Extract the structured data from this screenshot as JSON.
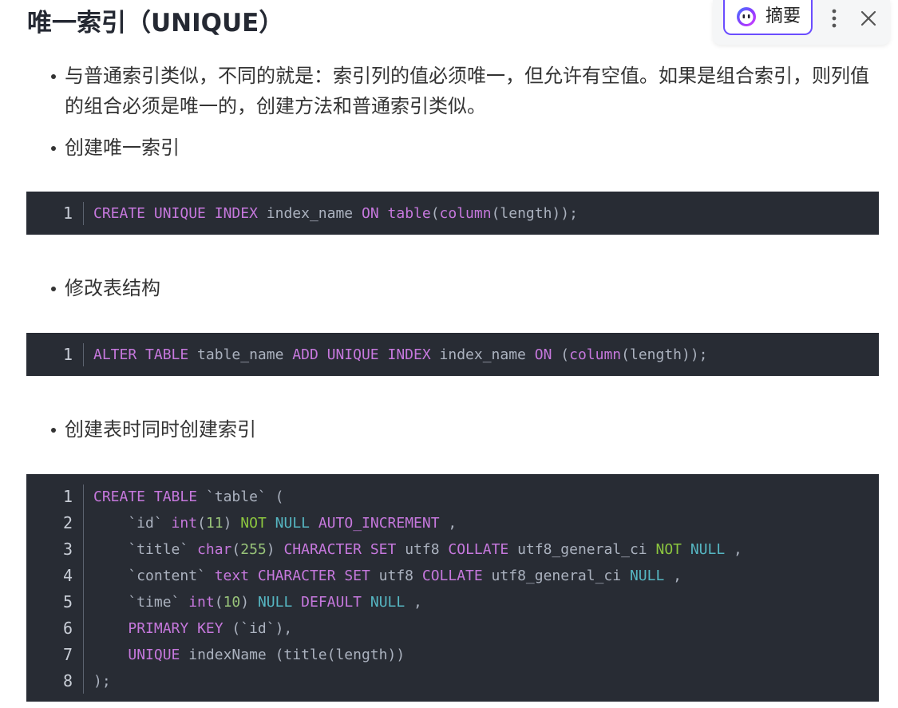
{
  "heading": "唯一索引（UNIQUE）",
  "bullets": [
    "与普通索引类似，不同的就是：索引列的值必须唯一，但允许有空值。如果是组合索引，则列值的组合必须是唯一的，创建方法和普通索引类似。",
    "创建唯一索引",
    "修改表结构",
    "创建表时同时创建索引"
  ],
  "code_blocks": [
    {
      "lines": [
        {
          "no": "1",
          "tokens": [
            {
              "t": "CREATE",
              "c": "kw"
            },
            {
              "t": " ",
              "c": "pl"
            },
            {
              "t": "UNIQUE",
              "c": "kw"
            },
            {
              "t": " ",
              "c": "pl"
            },
            {
              "t": "INDEX",
              "c": "kw"
            },
            {
              "t": " index_name ",
              "c": "pl"
            },
            {
              "t": "ON",
              "c": "kw"
            },
            {
              "t": " ",
              "c": "pl"
            },
            {
              "t": "table",
              "c": "kw"
            },
            {
              "t": "(",
              "c": "pl"
            },
            {
              "t": "column",
              "c": "fn"
            },
            {
              "t": "(length));",
              "c": "pl"
            }
          ]
        }
      ]
    },
    {
      "lines": [
        {
          "no": "1",
          "tokens": [
            {
              "t": "ALTER",
              "c": "kw"
            },
            {
              "t": " ",
              "c": "pl"
            },
            {
              "t": "TABLE",
              "c": "kw"
            },
            {
              "t": " table_name ",
              "c": "pl"
            },
            {
              "t": "ADD",
              "c": "kw"
            },
            {
              "t": " ",
              "c": "pl"
            },
            {
              "t": "UNIQUE",
              "c": "kw"
            },
            {
              "t": " ",
              "c": "pl"
            },
            {
              "t": "INDEX",
              "c": "kw"
            },
            {
              "t": " index_name ",
              "c": "pl"
            },
            {
              "t": "ON",
              "c": "kw"
            },
            {
              "t": " (",
              "c": "pl"
            },
            {
              "t": "column",
              "c": "fn"
            },
            {
              "t": "(length));",
              "c": "pl"
            }
          ]
        }
      ]
    },
    {
      "lines": [
        {
          "no": "1",
          "tokens": [
            {
              "t": "CREATE",
              "c": "kw"
            },
            {
              "t": " ",
              "c": "pl"
            },
            {
              "t": "TABLE",
              "c": "kw"
            },
            {
              "t": " `table` (",
              "c": "pl"
            }
          ]
        },
        {
          "no": "2",
          "tokens": [
            {
              "t": "    `id` ",
              "c": "pl"
            },
            {
              "t": "int",
              "c": "kw"
            },
            {
              "t": "(",
              "c": "pl"
            },
            {
              "t": "11",
              "c": "nu"
            },
            {
              "t": ") ",
              "c": "pl"
            },
            {
              "t": "NOT",
              "c": "gr"
            },
            {
              "t": " ",
              "c": "pl"
            },
            {
              "t": "NULL",
              "c": "cy"
            },
            {
              "t": " ",
              "c": "pl"
            },
            {
              "t": "AUTO_INCREMENT",
              "c": "kw"
            },
            {
              "t": " ,",
              "c": "pl"
            }
          ]
        },
        {
          "no": "3",
          "tokens": [
            {
              "t": "    `title` ",
              "c": "pl"
            },
            {
              "t": "char",
              "c": "kw"
            },
            {
              "t": "(",
              "c": "pl"
            },
            {
              "t": "255",
              "c": "nu"
            },
            {
              "t": ") ",
              "c": "pl"
            },
            {
              "t": "CHARACTER",
              "c": "kw"
            },
            {
              "t": " ",
              "c": "pl"
            },
            {
              "t": "SET",
              "c": "kw"
            },
            {
              "t": " utf8 ",
              "c": "pl"
            },
            {
              "t": "COLLATE",
              "c": "kw"
            },
            {
              "t": " utf8_general_ci ",
              "c": "pl"
            },
            {
              "t": "NOT",
              "c": "gr"
            },
            {
              "t": " ",
              "c": "pl"
            },
            {
              "t": "NULL",
              "c": "cy"
            },
            {
              "t": " ,",
              "c": "pl"
            }
          ]
        },
        {
          "no": "4",
          "tokens": [
            {
              "t": "    `content` ",
              "c": "pl"
            },
            {
              "t": "text",
              "c": "kw"
            },
            {
              "t": " ",
              "c": "pl"
            },
            {
              "t": "CHARACTER",
              "c": "kw"
            },
            {
              "t": " ",
              "c": "pl"
            },
            {
              "t": "SET",
              "c": "kw"
            },
            {
              "t": " utf8 ",
              "c": "pl"
            },
            {
              "t": "COLLATE",
              "c": "kw"
            },
            {
              "t": " utf8_general_ci ",
              "c": "pl"
            },
            {
              "t": "NULL",
              "c": "cy"
            },
            {
              "t": " ,",
              "c": "pl"
            }
          ]
        },
        {
          "no": "5",
          "tokens": [
            {
              "t": "    `time` ",
              "c": "pl"
            },
            {
              "t": "int",
              "c": "kw"
            },
            {
              "t": "(",
              "c": "pl"
            },
            {
              "t": "10",
              "c": "nu"
            },
            {
              "t": ") ",
              "c": "pl"
            },
            {
              "t": "NULL",
              "c": "cy"
            },
            {
              "t": " ",
              "c": "pl"
            },
            {
              "t": "DEFAULT",
              "c": "kw"
            },
            {
              "t": " ",
              "c": "pl"
            },
            {
              "t": "NULL",
              "c": "cy"
            },
            {
              "t": " ,",
              "c": "pl"
            }
          ]
        },
        {
          "no": "6",
          "tokens": [
            {
              "t": "    ",
              "c": "pl"
            },
            {
              "t": "PRIMARY",
              "c": "kw"
            },
            {
              "t": " ",
              "c": "pl"
            },
            {
              "t": "KEY",
              "c": "kw"
            },
            {
              "t": " (`id`),",
              "c": "pl"
            }
          ]
        },
        {
          "no": "7",
          "tokens": [
            {
              "t": "    ",
              "c": "pl"
            },
            {
              "t": "UNIQUE",
              "c": "kw"
            },
            {
              "t": " indexName (title(length))",
              "c": "pl"
            }
          ]
        },
        {
          "no": "8",
          "tokens": [
            {
              "t": ");",
              "c": "pl"
            }
          ]
        }
      ]
    }
  ],
  "summary_toolbar": {
    "summary_label": "摘要",
    "logo_icon": "ai-assistant-logo-icon",
    "more_icon": "more-vertical-icon",
    "close_icon": "close-icon"
  },
  "colors": {
    "code_background": "#282c34",
    "keyword": "#c678dd",
    "number": "#98c379",
    "null_keyword": "#56b6c2",
    "not_keyword": "#8cc63f",
    "summary_border": "#6b4dff"
  }
}
